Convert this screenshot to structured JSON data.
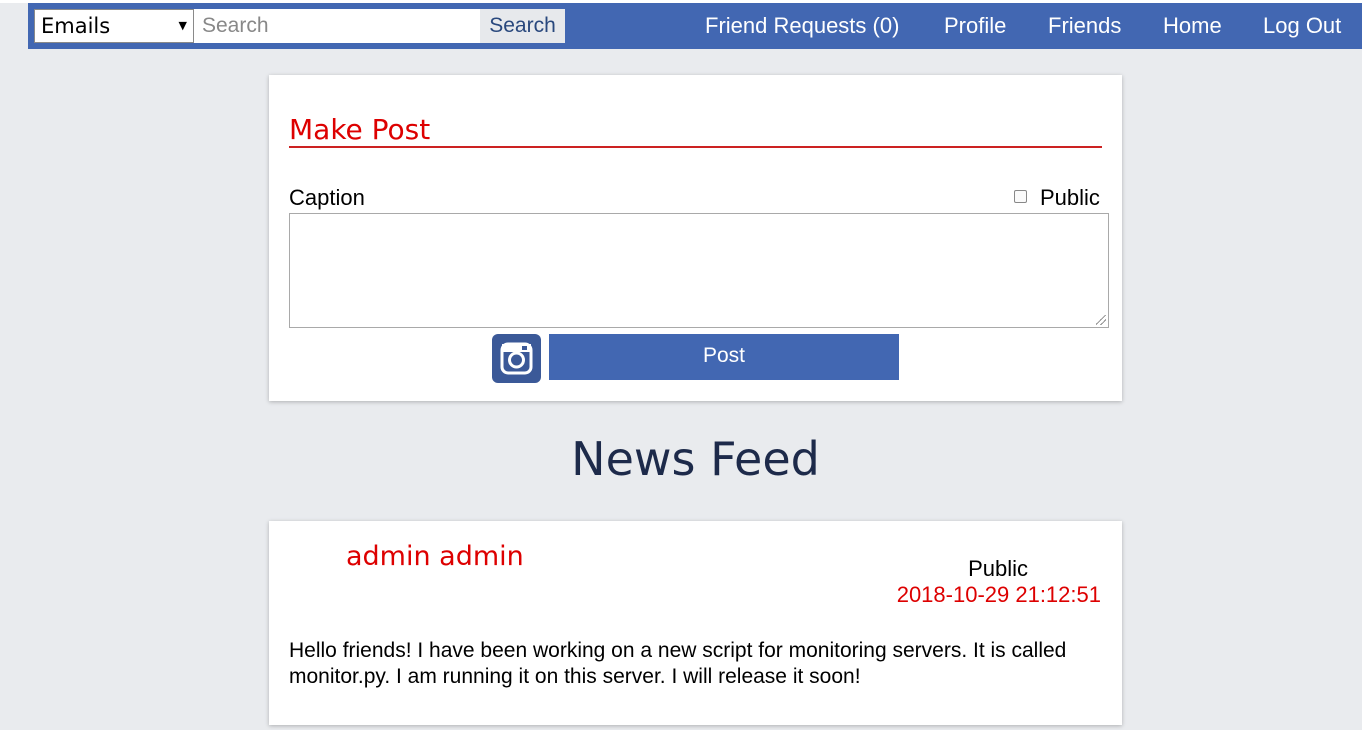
{
  "nav": {
    "select_value": "Emails",
    "search_placeholder": "Search",
    "search_button": "Search",
    "links": {
      "friend_requests": "Friend Requests (0)",
      "profile": "Profile",
      "friends": "Friends",
      "home": "Home",
      "logout": "Log Out"
    }
  },
  "make_post": {
    "title": "Make Post",
    "caption_label": "Caption",
    "public_label": "Public",
    "public_checked": false,
    "photo_icon": "instagram-camera-icon",
    "post_button": "Post"
  },
  "feed": {
    "title": "News Feed",
    "posts": [
      {
        "author": "admin admin",
        "visibility": "Public",
        "timestamp": "2018-10-29 21:12:51",
        "body": "Hello friends! I have been working on a new script for monitoring servers. It is called monitor.py. I am running it on this server. I will release it soon!"
      }
    ]
  },
  "colors": {
    "nav_bg": "#4267b2",
    "page_bg": "#e9ebee",
    "accent_red": "#dd0000",
    "heading_dark": "#1d2a4a"
  }
}
